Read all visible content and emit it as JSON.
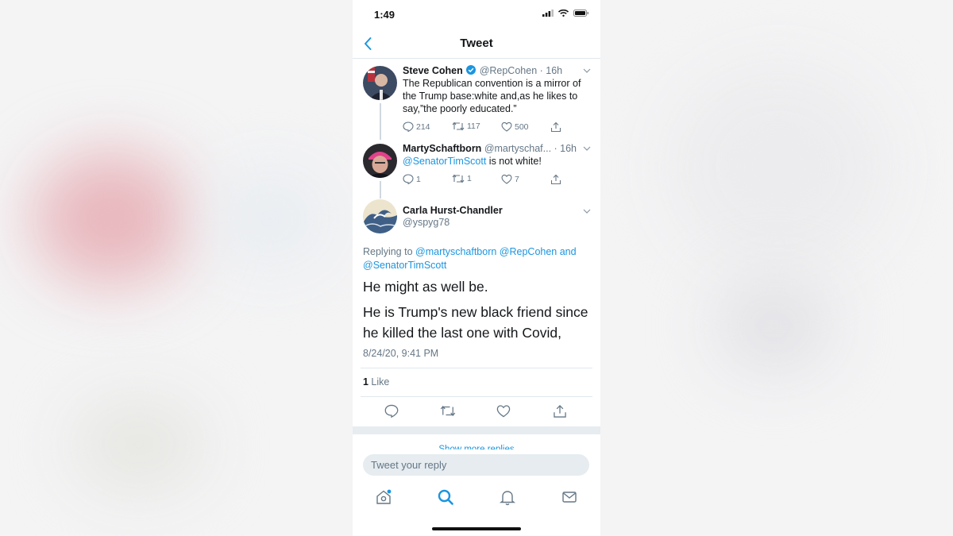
{
  "status_bar": {
    "time": "1:49"
  },
  "header": {
    "title": "Tweet"
  },
  "tweets": [
    {
      "name": "Steve Cohen",
      "handle_time": "@RepCohen · 16h",
      "verified": true,
      "text": "The Republican convention is a mirror of the Trump base:white and,as he likes to say,”the poorly educated.”",
      "replies": "214",
      "retweets": "117",
      "likes": "500"
    },
    {
      "name": "MartySchaftborn",
      "handle_time": "@martyschaf... · 16h",
      "mention": "@SenatorTimScott",
      "text": " is not white!",
      "replies": "1",
      "retweets": "1",
      "likes": "7"
    }
  ],
  "main_tweet": {
    "name": "Carla Hurst-Chandler",
    "handle": "@yspyg78",
    "replying_prefix": "Replying to ",
    "replying_to": "@martyschaftborn @RepCohen and @SenatorTimScott",
    "text_1": "He might as well be.",
    "text_2": "He is Trump's new black friend since he killed the last one with Covid,",
    "timestamp": "8/24/20, 9:41 PM",
    "like_count": "1",
    "like_label": " Like"
  },
  "show_more_label": "Show more replies",
  "reply_box": {
    "placeholder": "Tweet your reply"
  },
  "icons": {
    "back": "chevron-left-icon",
    "reply": "reply-icon",
    "retweet": "retweet-icon",
    "like": "heart-icon",
    "share": "share-icon",
    "tabs": [
      "home-icon",
      "search-icon",
      "bell-icon",
      "mail-icon"
    ]
  },
  "colors": {
    "accent": "#1b95e0",
    "text": "#14171a",
    "muted": "#657786",
    "divider": "#e1e8ed"
  }
}
